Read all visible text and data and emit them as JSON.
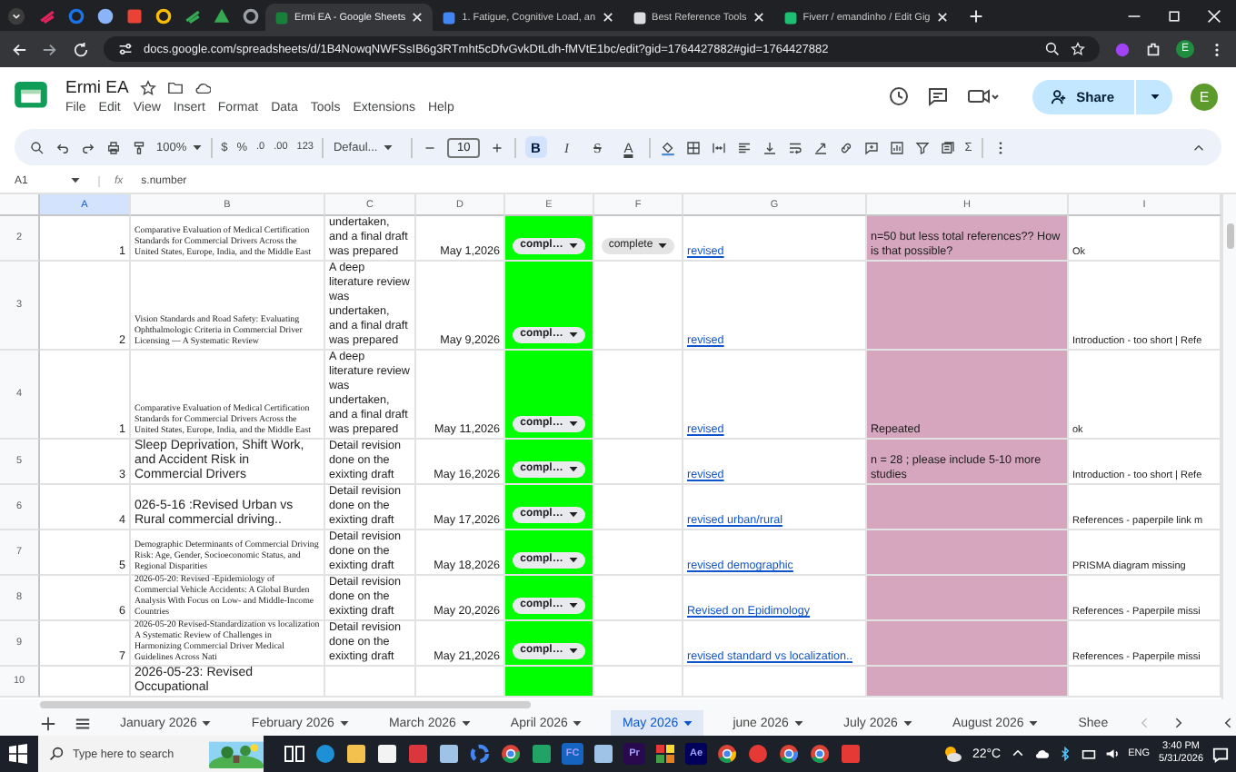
{
  "browser": {
    "tabs": [
      {
        "title": "Ermi EA - Google Sheets",
        "selected": true
      },
      {
        "title": "1. Fatigue, Cognitive Load, an",
        "selected": false
      },
      {
        "title": "Best Reference Tools",
        "selected": false
      },
      {
        "title": "Fiverr / emandinho / Edit Gig",
        "selected": false
      }
    ],
    "url": "docs.google.com/spreadsheets/d/1B4NowqNWFSsIB6g3RTmht5cDfvGvkDtLdh-fMVtE1bc/edit?gid=1764427882#gid=1764427882",
    "profile_initial": "E"
  },
  "doc": {
    "title": "Ermi EA",
    "menu": [
      "File",
      "Edit",
      "View",
      "Insert",
      "Format",
      "Data",
      "Tools",
      "Extensions",
      "Help"
    ],
    "share": "Share",
    "account_initial": "E"
  },
  "toolbar": {
    "zoom": "100%",
    "currency": "$",
    "percent": "%",
    "decrease_decimals": ".0",
    "increase_decimals": ".00",
    "number_format": "123",
    "font": "Defaul...",
    "font_size": "10",
    "text_styles": [
      {
        "label": "B",
        "kind": "bold",
        "on": true
      },
      {
        "label": "I",
        "kind": "italic",
        "on": false
      },
      {
        "label": "S",
        "kind": "strike",
        "on": false
      },
      {
        "label": "A",
        "kind": "color",
        "on": false
      }
    ],
    "sum": "Σ"
  },
  "formula_bar": {
    "cell_ref": "A1",
    "fx": "fx",
    "formula": "s.number"
  },
  "sheet": {
    "columns": [
      {
        "label": "A",
        "selected": true
      },
      {
        "label": "B",
        "selected": false
      },
      {
        "label": "C",
        "selected": false
      },
      {
        "label": "D",
        "selected": false
      },
      {
        "label": "E",
        "selected": false,
        "color": "#00ff00"
      },
      {
        "label": "F",
        "selected": false
      },
      {
        "label": "G",
        "selected": false
      },
      {
        "label": "H",
        "selected": false,
        "color": "#d5a6bd"
      },
      {
        "label": "I",
        "selected": false
      }
    ],
    "rows": [
      {
        "number": "2",
        "a": "1",
        "b": "Comparative Evaluation of Medical Certification Standards for Commercial Drivers Across the United States, Europe, India, and the Middle East",
        "kind": "small-serif",
        "c": "undertaken, and a final draft was prepared",
        "d": "May 1,2026",
        "e": "compl…",
        "f": "complete",
        "g": "revised",
        "h": "n=50 but less total references?? How is that possible?",
        "i": "Ok"
      },
      {
        "number": "3",
        "a": "2",
        "b": "Vision Standards and Road Safety: Evaluating Ophthalmologic Criteria in Commercial Driver Licensing — A Systematic Review",
        "kind": "small-serif",
        "c": "A deep literature review was undertaken, and a final draft was prepared",
        "d": "May 9,2026",
        "e": "compl…",
        "g": "revised",
        "i": "Introduction - too short | Refe"
      },
      {
        "number": "4",
        "a": "1",
        "b": "Comparative Evaluation of Medical Certification Standards for Commercial Drivers Across the United States, Europe, India, and the Middle East",
        "kind": "small-serif",
        "c": "A deep literature review was undertaken, and a final draft was prepared",
        "d": "May 11,2026",
        "e": "compl…",
        "g": "revised",
        "h": "Repeated",
        "i": "ok"
      },
      {
        "number": "5",
        "a": "3",
        "b": "Sleep Deprivation, Shift Work, and Accident Risk in Commercial Drivers",
        "kind": "plain",
        "c": "Detail revision done on the exixting draft",
        "d": "May 16,2026",
        "e": "compl…",
        "g": "revised",
        "h": "n = 28 ; please include 5-10 more studies",
        "i": "Introduction - too short | Refe"
      },
      {
        "number": "6",
        "a": "4",
        "b": "026-5-16 :Revised  Urban vs Rural commercial driving..",
        "kind": "plain",
        "c": "Detail revision done on the exixting draft",
        "d": "May 17,2026",
        "e": "compl…",
        "g": "revised urban/rural",
        "i": "References - paperpile link m"
      },
      {
        "number": "7",
        "a": "5",
        "b": "Demographic Determinants of Commercial Driving Risk: Age, Gender, Socioeconomic Status, and Regional Disparities",
        "kind": "small-serif",
        "c": "Detail revision done on the exixting draft",
        "d": "May 18,2026",
        "e": "compl…",
        "g": "revised demographic",
        "i": "PRISMA diagram missing"
      },
      {
        "number": "8",
        "a": "6",
        "b": "2026-05-20: Revised -Epidemiology of Commercial Vehicle Accidents: A Global Burden Analysis With Focus on Low- and Middle-Income Countries",
        "kind": "small-serif",
        "c": "Detail revision done on the exixting draft",
        "d": "May 20,2026",
        "e": "compl…",
        "g": "Revised on Epidimology",
        "i": "References - Paperpile missi"
      },
      {
        "number": "9",
        "a": "7",
        "b": "2026-05-20 Revised-Standardization vs localization A Systematic Review of Challenges in Harmonizing Commercial Driver Medical Guidelines Across Nati",
        "kind": "small-serif",
        "c": "Detail revision done on the exixting draft",
        "d": "May 21,2026",
        "e": "compl…",
        "g": "revised standard vs localization..",
        "i": "References - Paperpile missi"
      },
      {
        "number": "10",
        "b": "2026-05-23: Revised  Occupational",
        "kind": "plain"
      }
    ]
  },
  "sheet_tabs": [
    {
      "label": "January 2026",
      "selected": false
    },
    {
      "label": "February 2026",
      "selected": false
    },
    {
      "label": "March 2026",
      "selected": false
    },
    {
      "label": "April 2026",
      "selected": false
    },
    {
      "label": "May 2026",
      "selected": true
    },
    {
      "label": "june 2026",
      "selected": false
    },
    {
      "label": "July 2026",
      "selected": false
    },
    {
      "label": "August 2026",
      "selected": false
    },
    {
      "label": "Shee",
      "selected": false
    }
  ],
  "taskbar": {
    "search_placeholder": "Type here to search",
    "app_letters": [
      "FC",
      "Pr",
      "Ae"
    ],
    "temperature": "22°C",
    "language": "ENG",
    "time": "3:40 PM",
    "date": "5/31/2026"
  }
}
